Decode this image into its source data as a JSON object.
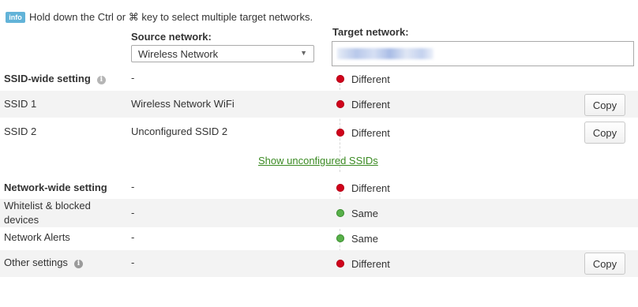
{
  "info": {
    "badge": "info",
    "text": "Hold down the Ctrl or ⌘ key to select multiple target networks."
  },
  "source": {
    "label": "Source network:",
    "selected": "Wireless Network"
  },
  "target": {
    "label": "Target network:"
  },
  "ssid_section": {
    "header": {
      "name": "SSID-wide setting",
      "source": "-",
      "status": "Different"
    },
    "rows": [
      {
        "name": "SSID 1",
        "source": "Wireless Network WiFi",
        "status": "Different",
        "button": "Copy"
      },
      {
        "name": "SSID 2",
        "source": "Unconfigured SSID 2",
        "status": "Different",
        "button": "Copy"
      }
    ],
    "show_link": "Show unconfigured SSIDs"
  },
  "network_section": {
    "header": {
      "name": "Network-wide setting",
      "source": "-",
      "status": "Different"
    },
    "rows": [
      {
        "name_line1": "Whitelist & blocked",
        "name_line2": "devices",
        "source": "-",
        "status": "Same"
      },
      {
        "name": "Network Alerts",
        "source": "-",
        "status": "Same"
      },
      {
        "name": "Other settings",
        "source": "-",
        "status": "Different",
        "button": "Copy"
      }
    ]
  },
  "colors": {
    "different": "#d0021b",
    "same": "#58b04a",
    "link": "#3a8a22",
    "info_badge": "#62b3d8"
  }
}
